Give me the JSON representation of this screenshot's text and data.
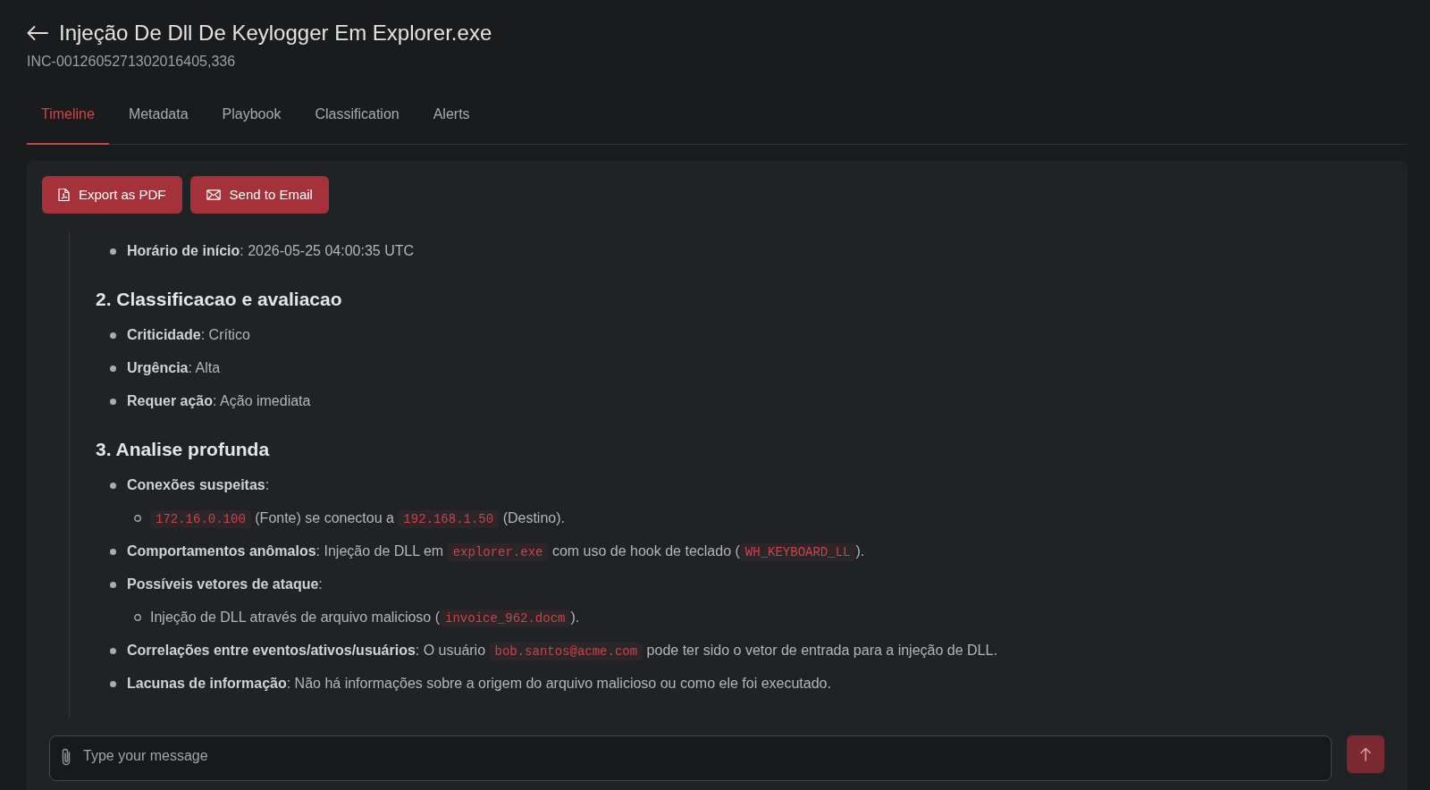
{
  "header": {
    "title": "Injeção De Dll De Keylogger Em Explorer.exe",
    "incident_id": "INC-0012605271302016405,336"
  },
  "tabs": [
    {
      "label": "Timeline",
      "selected": true
    },
    {
      "label": "Metadata",
      "selected": false
    },
    {
      "label": "Playbook",
      "selected": false
    },
    {
      "label": "Classification",
      "selected": false
    },
    {
      "label": "Alerts",
      "selected": false
    }
  ],
  "actions": [
    {
      "kind": "pdf",
      "label": "Export as PDF"
    },
    {
      "kind": "email",
      "label": "Send to Email"
    }
  ],
  "report": [
    {
      "kind": "list",
      "items": [
        {
          "segments": [
            {
              "kind": "text",
              "text": "**Horário de início**: 2026-05-25 04:00:35 UTC"
            }
          ]
        }
      ]
    },
    {
      "kind": "heading",
      "text": "2. Classificacao e avaliacao"
    },
    {
      "kind": "list",
      "items": [
        {
          "segments": [
            {
              "kind": "text",
              "text": "**Criticidade**: Crítico"
            }
          ]
        },
        {
          "segments": [
            {
              "kind": "text",
              "text": "**Urgência**: Alta"
            }
          ]
        },
        {
          "segments": [
            {
              "kind": "text",
              "text": "**Requer ação**: Ação imediata"
            }
          ]
        }
      ]
    },
    {
      "kind": "heading",
      "text": "3. Analise profunda"
    },
    {
      "kind": "list",
      "items": [
        {
          "segments": [
            {
              "kind": "text",
              "text": "**Conexões suspeitas**:"
            }
          ],
          "children": [
            {
              "segments": [
                {
                  "kind": "code",
                  "text": "172.16.0.100"
                },
                {
                  "kind": "text",
                  "text": " (Fonte) se conectou a "
                },
                {
                  "kind": "code",
                  "text": "192.168.1.50"
                },
                {
                  "kind": "text",
                  "text": " (Destino)."
                }
              ]
            }
          ]
        },
        {
          "segments": [
            {
              "kind": "text",
              "text": "**Comportamentos anômalos**: Injeção de DLL em "
            },
            {
              "kind": "code",
              "text": "explorer.exe"
            },
            {
              "kind": "text",
              "text": " com uso de hook de teclado ("
            },
            {
              "kind": "code",
              "text": "WH_KEYBOARD_LL"
            },
            {
              "kind": "text",
              "text": ")."
            }
          ]
        },
        {
          "segments": [
            {
              "kind": "text",
              "text": "**Possíveis vetores de ataque**:"
            }
          ],
          "children": [
            {
              "segments": [
                {
                  "kind": "text",
                  "text": "Injeção de DLL através de arquivo malicioso ("
                },
                {
                  "kind": "code",
                  "text": "invoice_962.docm"
                },
                {
                  "kind": "text",
                  "text": ")."
                }
              ]
            }
          ]
        },
        {
          "segments": [
            {
              "kind": "text",
              "text": "**Correlações entre eventos/ativos/usuários**: O usuário "
            },
            {
              "kind": "code",
              "text": "bob.santos@acme.com"
            },
            {
              "kind": "text",
              "text": " pode ter sido o vetor de entrada para a injeção de DLL."
            }
          ]
        },
        {
          "segments": [
            {
              "kind": "text",
              "text": "**Lacunas de informação**: Não há informações sobre a origem do arquivo malicioso ou como ele foi executado."
            }
          ]
        }
      ]
    }
  ],
  "composer": {
    "placeholder": "Type your message",
    "send_disabled": true
  }
}
